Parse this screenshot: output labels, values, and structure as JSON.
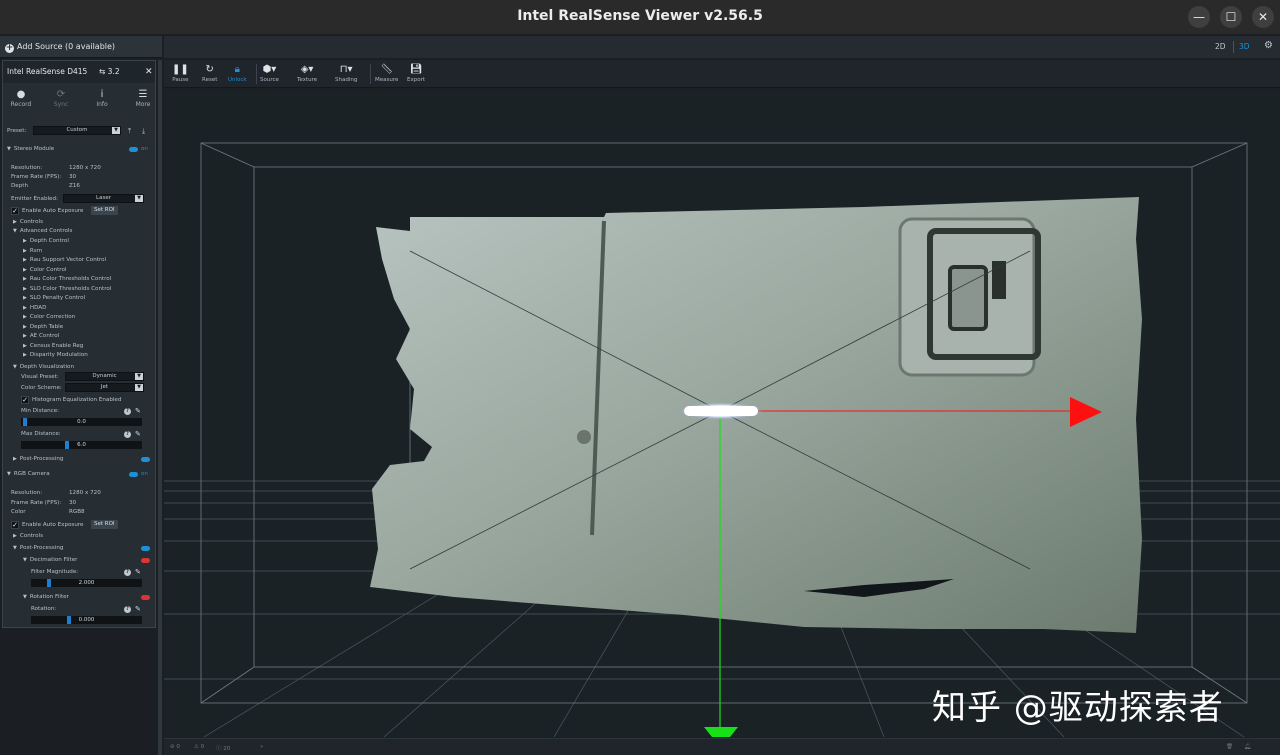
{
  "window": {
    "title": "Intel RealSense Viewer v2.56.5",
    "minimize": "—",
    "maximize": "☐",
    "close": "✕"
  },
  "sources": {
    "add_label": "Add Source (0 available)"
  },
  "device": {
    "name": "Intel RealSense D415",
    "usb": "⇆ 3.2",
    "close": "✕",
    "buttons": [
      {
        "icon": "●",
        "label": "Record"
      },
      {
        "icon": "⟳",
        "label": "Sync"
      },
      {
        "icon": "i",
        "label": "Info"
      },
      {
        "icon": "☰",
        "label": "More"
      }
    ],
    "preset_label": "Preset:",
    "preset_value": "Custom",
    "upload_icon": "⤒",
    "download_icon": "⤓"
  },
  "stereo": {
    "title": "Stereo Module",
    "on": "on",
    "resolution_k": "Resolution:",
    "resolution_v": "1280 x 720",
    "fps_k": "Frame Rate (FPS):",
    "fps_v": "30",
    "depth_k": "Depth",
    "depth_v": "Z16",
    "emitter_k": "Emitter Enabled:",
    "emitter_v": "Laser",
    "auto_exposure": "Enable Auto Exposure",
    "set_roi": "Set ROI",
    "controls": "Controls",
    "advanced": "Advanced Controls",
    "advanced_items": [
      "Depth Control",
      "Rsm",
      "Rau Support Vector Control",
      "Color Control",
      "Rau Color Thresholds Control",
      "SLO Color Thresholds Control",
      "SLO Penalty Control",
      "HDAD",
      "Color Correction",
      "Depth Table",
      "AE Control",
      "Census Enable Reg",
      "Disparity Modulation"
    ],
    "depth_vis": "Depth Visualization",
    "visual_preset_k": "Visual Preset:",
    "visual_preset_v": "Dynamic",
    "color_scheme_k": "Color Scheme:",
    "color_scheme_v": "Jet",
    "histogram": "Histogram Equalization Enabled",
    "min_dist_k": "Min Distance:",
    "min_dist_v": "0.0",
    "max_dist_k": "Max Distance:",
    "max_dist_v": "6.0",
    "post": "Post-Processing"
  },
  "rgb": {
    "title": "RGB Camera",
    "on": "on",
    "resolution_k": "Resolution:",
    "resolution_v": "1280 x 720",
    "fps_k": "Frame Rate (FPS):",
    "fps_v": "30",
    "color_k": "Color",
    "color_v": "RGB8",
    "auto_exposure": "Enable Auto Exposure",
    "set_roi": "Set ROI",
    "controls": "Controls",
    "post": "Post-Processing",
    "decimation": "Decimation Filter",
    "filter_mag_k": "Filter Magnitude:",
    "filter_mag_v": "2.000",
    "rotation": "Rotation Filter",
    "rotation_k": "Rotation:",
    "rotation_v": "0.000"
  },
  "view": {
    "tab_2d": "2D",
    "tab_3d": "3D",
    "settings": "⚙"
  },
  "toolbar": {
    "pause": "Pause",
    "reset": "Reset",
    "unlock": "Unlock",
    "source": "Source",
    "texture": "Texture",
    "shading": "Shading",
    "measure": "Measure",
    "export": "Export"
  },
  "status": {
    "errors": "⊘ 0",
    "warnings": "⚠ 0",
    "info": "ⓘ 20",
    "arrow": "»"
  },
  "watermark": "知乎 @驱动探索者",
  "colors": {
    "accent": "#1e90d6",
    "axis_x": "#ff1010",
    "axis_y": "#18e018"
  }
}
